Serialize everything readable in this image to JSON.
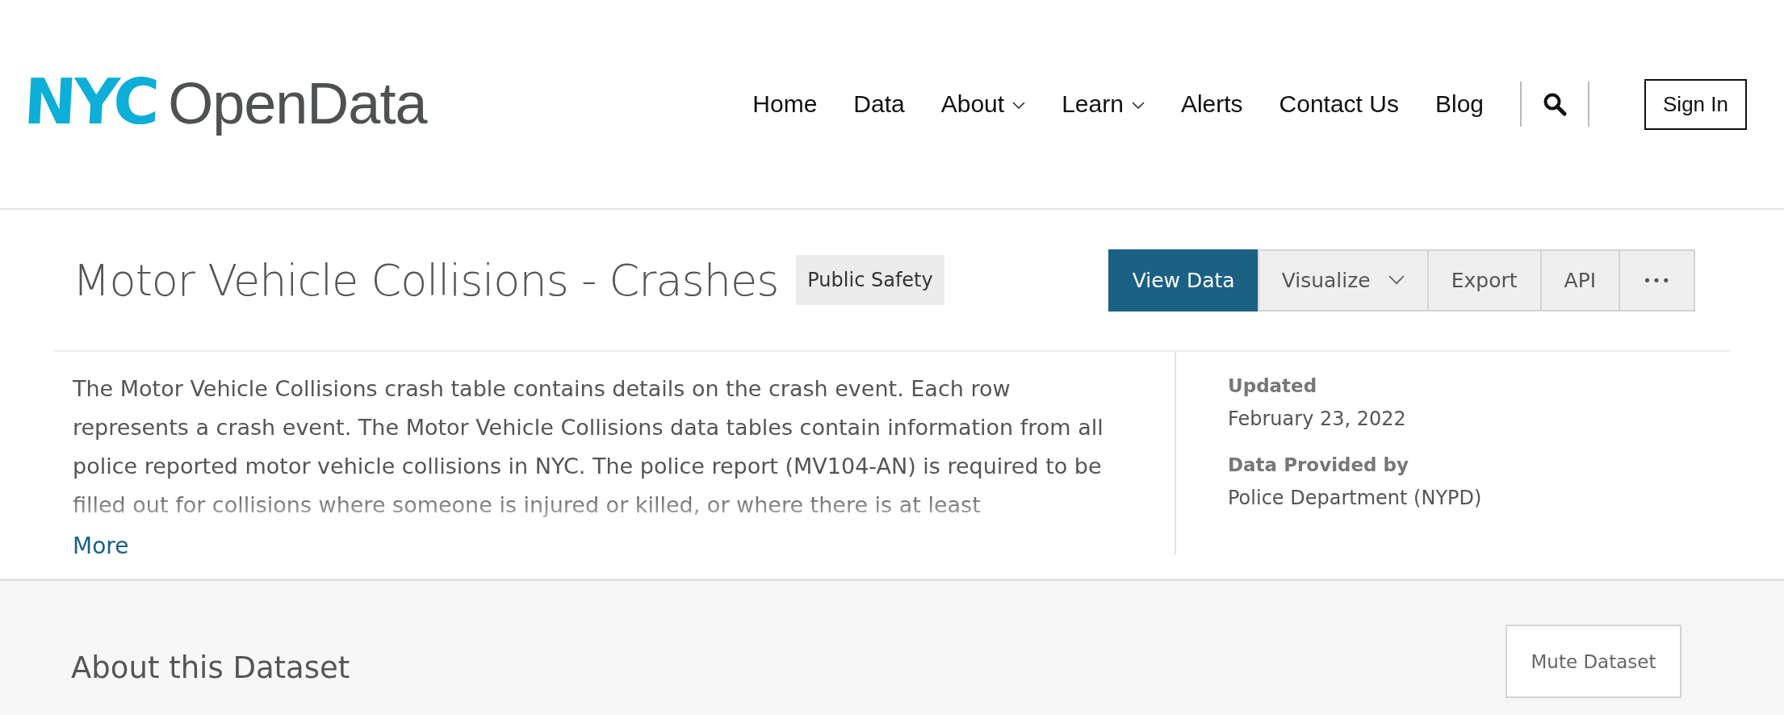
{
  "logo": {
    "mark": "NYC",
    "name": "OpenData"
  },
  "nav": [
    {
      "label": "Home",
      "dropdown": false
    },
    {
      "label": "Data",
      "dropdown": false
    },
    {
      "label": "About",
      "dropdown": true
    },
    {
      "label": "Learn",
      "dropdown": true
    },
    {
      "label": "Alerts",
      "dropdown": false
    },
    {
      "label": "Contact Us",
      "dropdown": false
    },
    {
      "label": "Blog",
      "dropdown": false
    }
  ],
  "sign_in": "Sign In",
  "dataset": {
    "title": "Motor Vehicle Collisions - Crashes",
    "tag": "Public Safety",
    "actions": [
      {
        "label": "View Data",
        "selected": true,
        "dropdown": false,
        "kind": "text"
      },
      {
        "label": "Visualize",
        "selected": false,
        "dropdown": true,
        "kind": "text"
      },
      {
        "label": "Export",
        "selected": false,
        "dropdown": false,
        "kind": "text"
      },
      {
        "label": "API",
        "selected": false,
        "dropdown": false,
        "kind": "text"
      },
      {
        "label": "•••",
        "selected": false,
        "dropdown": false,
        "kind": "more"
      }
    ],
    "description": "The Motor Vehicle Collisions crash table contains details on the crash event. Each row represents a crash event. The Motor Vehicle Collisions data tables contain information from all police reported motor vehicle collisions in NYC. The police report (MV104-AN) is required to be filled out for collisions where someone is injured or killed, or where there is at least",
    "more_link": "More",
    "meta": [
      {
        "label": "Updated",
        "value": "February 23, 2022"
      },
      {
        "label": "Data Provided by",
        "value": "Police Department (NYPD)"
      }
    ]
  },
  "about": {
    "heading": "About this Dataset",
    "mute_button": "Mute Dataset"
  }
}
